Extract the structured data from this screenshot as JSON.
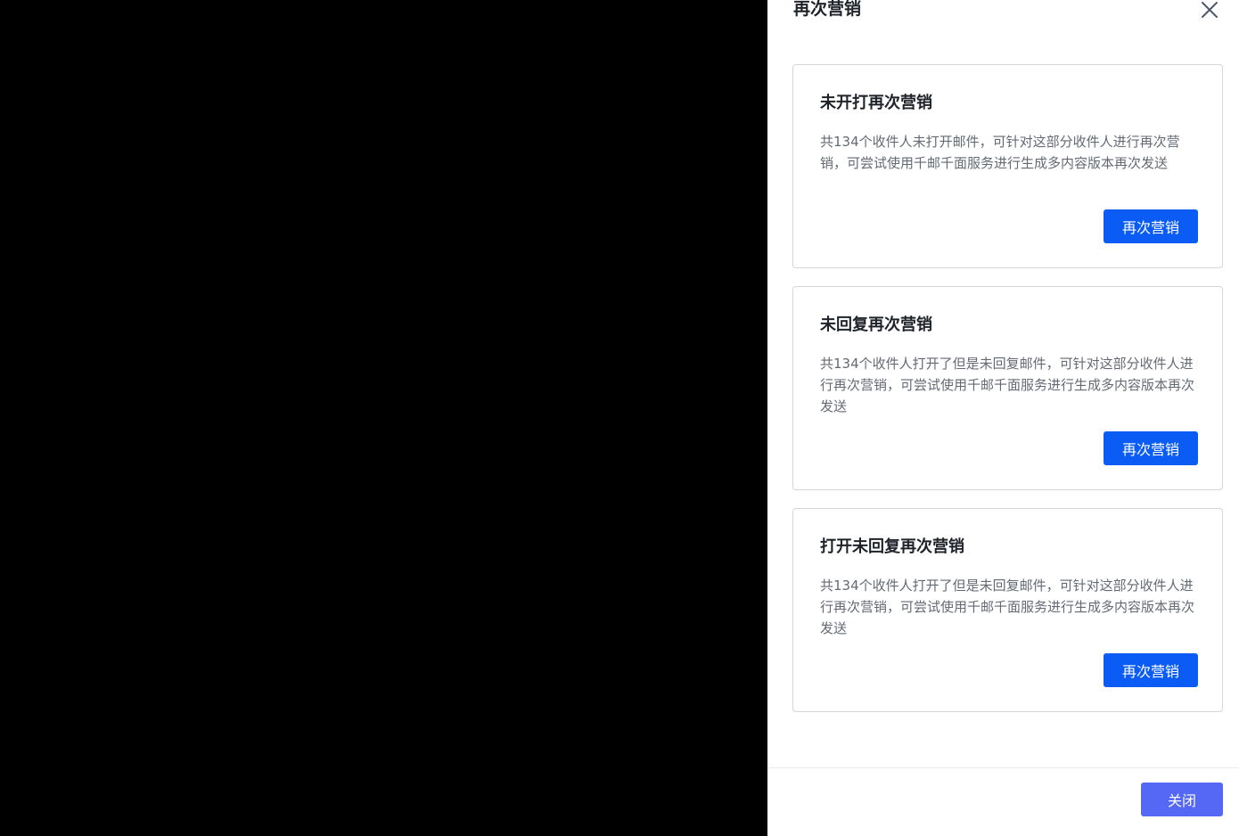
{
  "drawer": {
    "title": "再次营销",
    "close_icon": "close-icon"
  },
  "cards": [
    {
      "title": "未开打再次营销",
      "description": "共134个收件人未打开邮件，可针对这部分收件人进行再次营销，可尝试使用千邮千面服务进行生成多内容版本再次发送",
      "button_label": "再次营销"
    },
    {
      "title": "未回复再次营销",
      "description": "共134个收件人打开了但是未回复邮件，可针对这部分收件人进行再次营销，可尝试使用千邮千面服务进行生成多内容版本再次发送",
      "button_label": "再次营销"
    },
    {
      "title": "打开未回复再次营销",
      "description": "共134个收件人打开了但是未回复邮件，可针对这部分收件人进行再次营销，可尝试使用千邮千面服务进行生成多内容版本再次发送",
      "button_label": "再次营销"
    }
  ],
  "footer": {
    "close_label": "关闭"
  },
  "colors": {
    "primary": "#0a5cf5",
    "footer_button": "#5468f5",
    "overlay": "#000000"
  }
}
